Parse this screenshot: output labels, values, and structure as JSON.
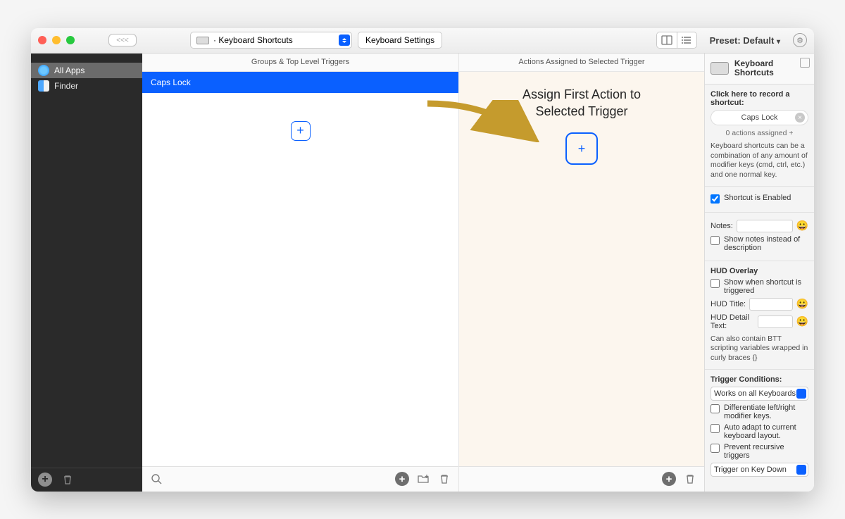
{
  "toolbar": {
    "back_label": "<<<",
    "dropdown_label": "· Keyboard Shortcuts",
    "settings_button": "Keyboard Settings",
    "preset_label": "Preset: Default",
    "preset_caret": "▾"
  },
  "sidebar": {
    "items": [
      {
        "label": "All Apps",
        "selected": true,
        "icon": "globe"
      },
      {
        "label": "Finder",
        "selected": false,
        "icon": "finder"
      }
    ]
  },
  "columns": {
    "header_triggers": "Groups & Top Level Triggers",
    "header_actions": "Actions Assigned to Selected Trigger"
  },
  "triggers": {
    "selected_label": "Caps Lock"
  },
  "actions": {
    "heading_line1": "Assign First Action to",
    "heading_line2": "Selected Trigger"
  },
  "inspector": {
    "title": "Keyboard Shortcuts",
    "record_label": "Click here to record a shortcut:",
    "shortcut_value": "Caps Lock",
    "actions_assigned": "0 actions assigned +",
    "help_text": "Keyboard shortcuts can be a combination of any amount of modifier keys (cmd, ctrl, etc.) and one normal key.",
    "enabled_label": "Shortcut is Enabled",
    "notes_label": "Notes:",
    "show_notes_label": "Show notes instead of description",
    "hud_section": "HUD Overlay",
    "hud_show_label": "Show when shortcut is triggered",
    "hud_title_label": "HUD Title:",
    "hud_detail_label": "HUD Detail Text:",
    "hud_help": "Can also contain BTT scripting variables wrapped in curly braces {}",
    "trigger_conditions_label": "Trigger Conditions:",
    "works_on": "Works on all Keyboards",
    "differentiate_label": "Differentiate left/right modifier keys.",
    "autoadapt_label": "Auto adapt to current keyboard layout.",
    "prevent_recursive_label": "Prevent recursive triggers",
    "trigger_on": "Trigger on Key Down"
  }
}
